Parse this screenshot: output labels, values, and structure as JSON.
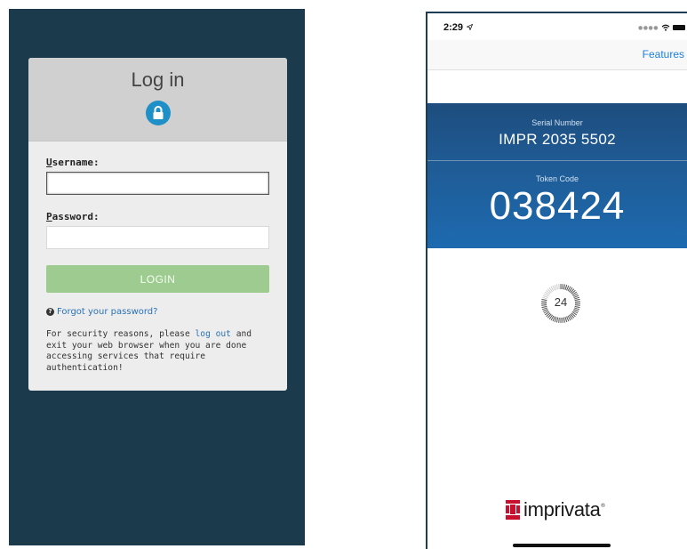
{
  "login": {
    "title": "Log in",
    "username_label_first": "U",
    "username_label_rest": "sername:",
    "username_value": "",
    "password_label_first": "P",
    "password_label_rest": "assword:",
    "password_value": "",
    "login_button": "LOGIN",
    "forgot_link": "Forgot your password?",
    "note_before": "For security reasons, please ",
    "note_link": "log out",
    "note_after": " and exit your web browser when you are done accessing services that require authentication!",
    "colors": {
      "background": "#1b3a4b",
      "button": "#9ecb90",
      "link": "#2a72b5",
      "lock_badge": "#1f8fc7"
    },
    "icons": [
      "lock-icon",
      "question-circle-icon"
    ]
  },
  "phone": {
    "status_time": "2:29",
    "status_icons": [
      "location-arrow-icon",
      "signal-dots-icon",
      "wifi-icon",
      "battery-icon"
    ],
    "nav_link": "Features",
    "serial_label": "Serial Number",
    "serial_value": "IMPR 2035 5502",
    "token_label": "Token Code",
    "token_value": "038424",
    "countdown_seconds": "24",
    "countdown_fraction_remaining": 0.8,
    "brand_name": "imprivata",
    "brand_tm": "®",
    "colors": {
      "panel_top": "#1e4d7e",
      "panel_bottom": "#1d6ab0",
      "link": "#1d7fe0",
      "brand_mark": "#c8102e"
    }
  }
}
